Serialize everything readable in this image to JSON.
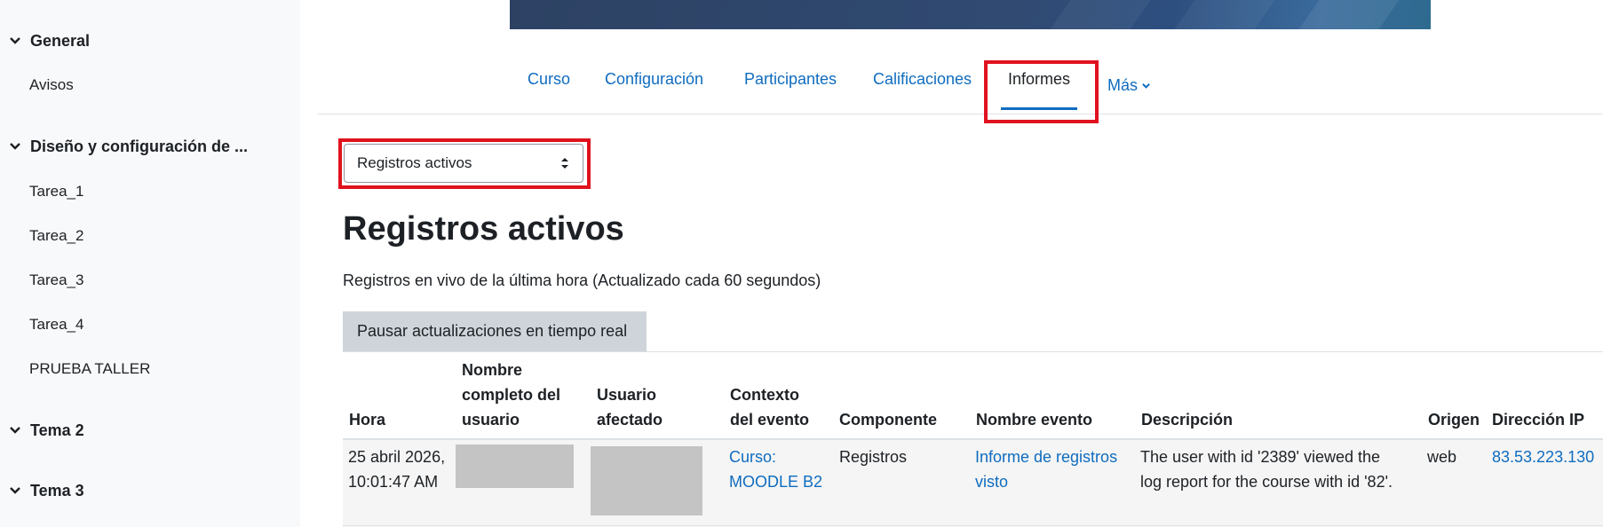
{
  "sidebar": {
    "sections": [
      {
        "label": "General",
        "items": [
          "Avisos"
        ]
      },
      {
        "label": "Diseño y configuración de ...",
        "items": [
          "Tarea_1",
          "Tarea_2",
          "Tarea_3",
          "Tarea_4",
          "PRUEBA TALLER"
        ]
      },
      {
        "label": "Tema 2",
        "items": []
      },
      {
        "label": "Tema 3",
        "items": []
      }
    ]
  },
  "nav": {
    "tabs": [
      "Curso",
      "Configuración",
      "Participantes",
      "Calificaciones",
      "Informes",
      "Más"
    ],
    "active": "Informes"
  },
  "report_select": {
    "value": "Registros activos"
  },
  "page": {
    "title": "Registros activos",
    "subtitle": "Registros en vivo de la última hora (Actualizado cada 60 segundos)",
    "pause_button": "Pausar actualizaciones en tiempo real"
  },
  "table": {
    "headers": {
      "time": "Hora",
      "user_fullname": [
        "Nombre",
        "completo del",
        "usuario"
      ],
      "affected_user": [
        "Usuario",
        "afectado"
      ],
      "context": [
        "Contexto",
        "del evento"
      ],
      "component": "Componente",
      "event_name": "Nombre evento",
      "description": "Descripción",
      "origin": "Origen",
      "ip": "Dirección IP"
    },
    "rows": [
      {
        "time": [
          "25 abril 2026,",
          "10:01:47 AM"
        ],
        "context": [
          "Curso:",
          "MOODLE B2"
        ],
        "component": "Registros",
        "event_name": [
          "Informe de registros",
          "visto"
        ],
        "description": [
          "The user with id '2389' viewed the",
          "log report for the course with id '82'."
        ],
        "origin": "web",
        "ip": "83.53.223.130"
      }
    ]
  },
  "colors": {
    "link": "#0f6cbf",
    "highlight": "#e0121e",
    "sidebar_bg": "#f8f9fa",
    "button_bg": "#ced4da"
  }
}
